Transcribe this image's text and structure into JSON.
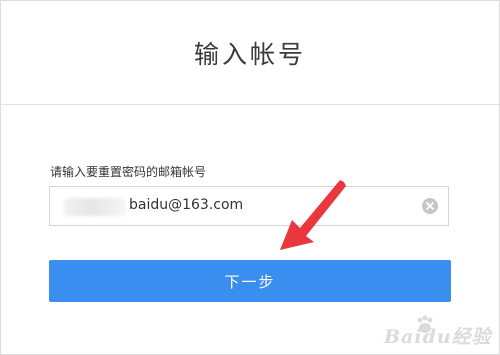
{
  "header": {
    "title": "输入帐号"
  },
  "form": {
    "label": "请输入要重置密码的邮箱帐号",
    "email_value": "baidu@163.com"
  },
  "actions": {
    "next_label": "下一步"
  },
  "colors": {
    "primary": "#3a8ef0",
    "arrow": "#e8383d"
  },
  "watermark": {
    "text": "Baidu经验"
  }
}
